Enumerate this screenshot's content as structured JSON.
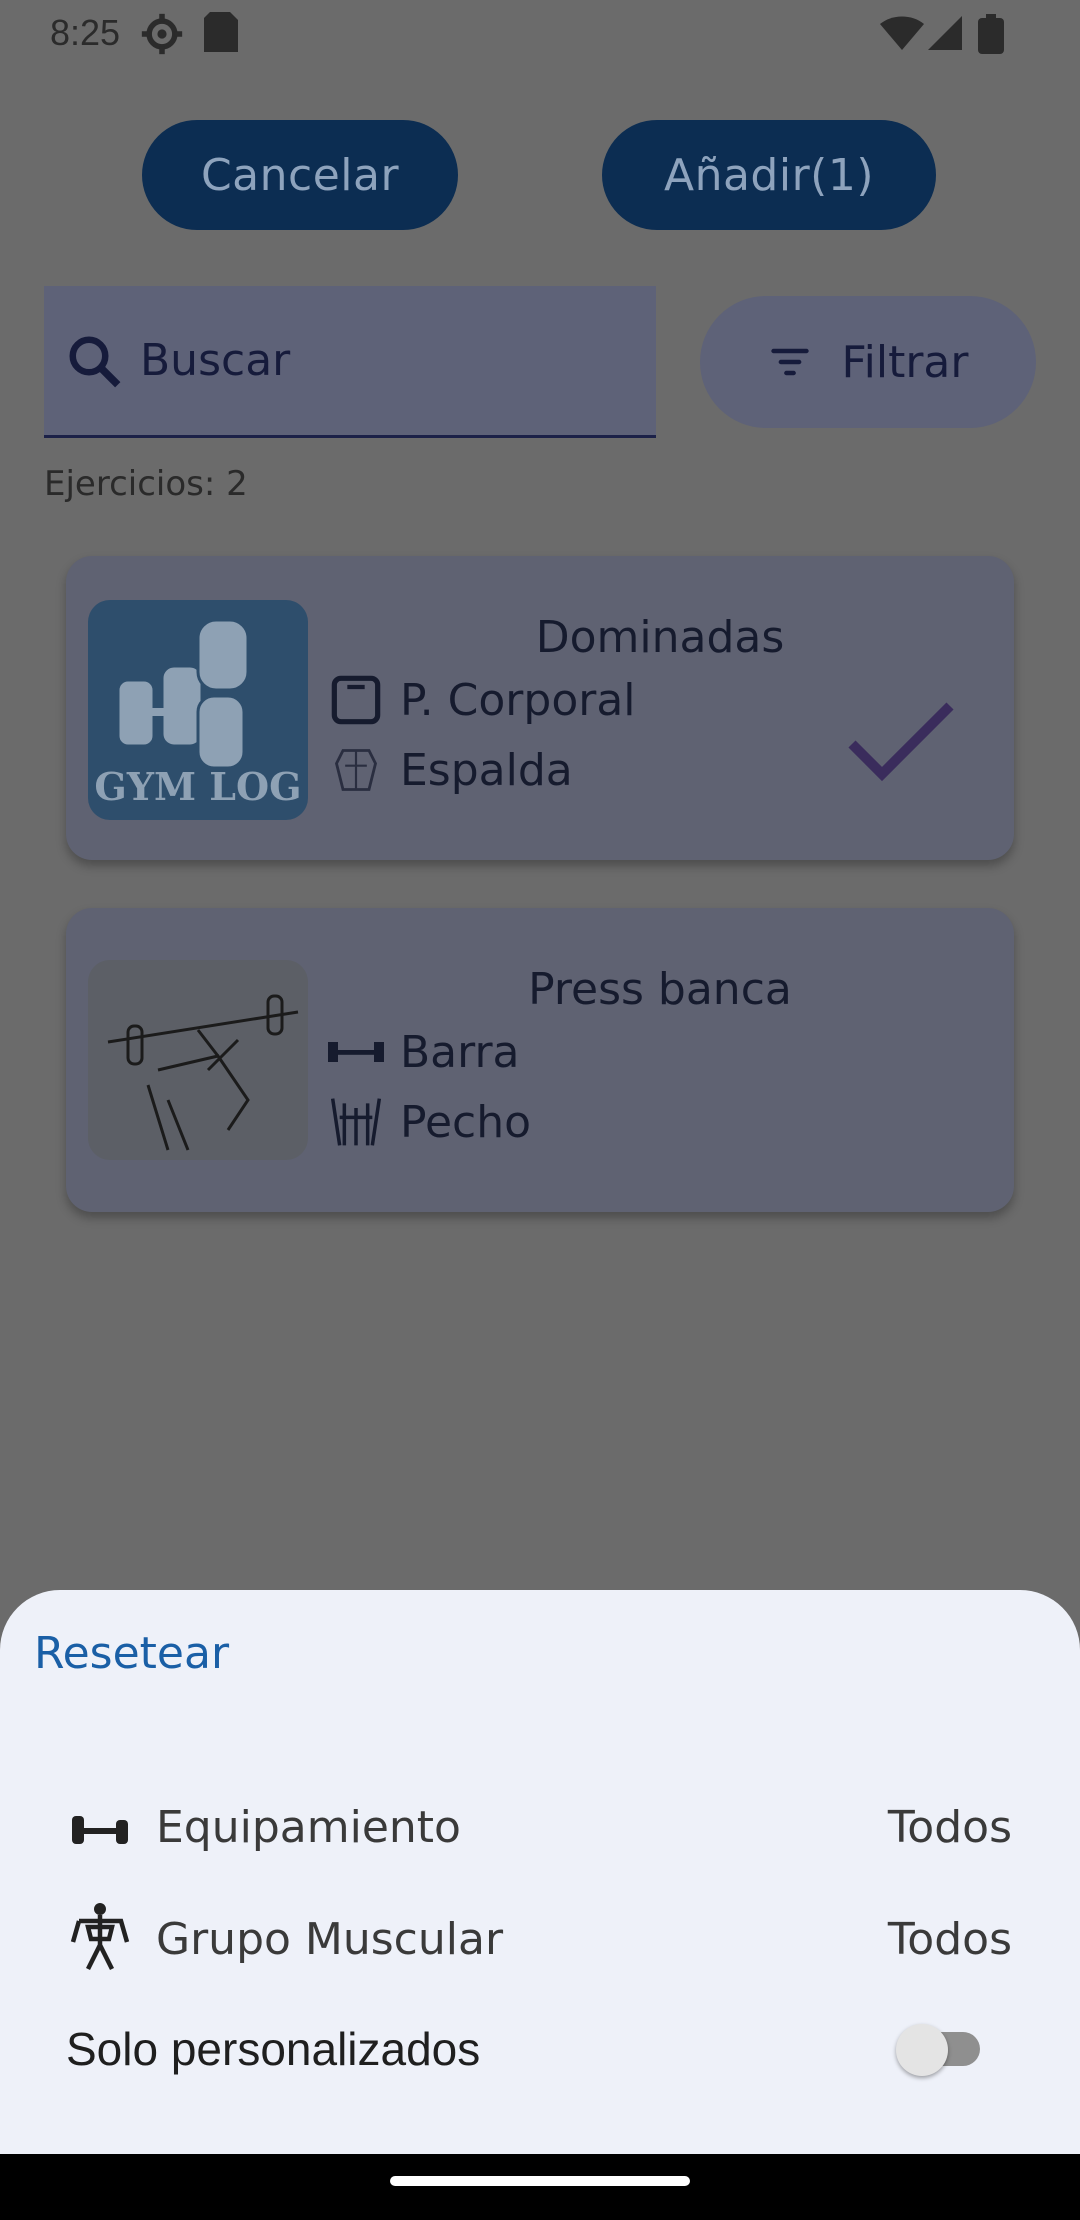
{
  "status_bar": {
    "time": "8:25"
  },
  "header": {
    "cancel_label": "Cancelar",
    "add_label": "Añadir(1)"
  },
  "search": {
    "placeholder": "Buscar"
  },
  "filter": {
    "label": "Filtrar"
  },
  "list": {
    "count_label": "Ejercicios: 2",
    "exercises": [
      {
        "name": "Dominadas",
        "equipment": "P. Corporal",
        "muscle": "Espalda",
        "selected": true,
        "thumb_logo": "GYM LOG"
      },
      {
        "name": "Press banca",
        "equipment": "Barra",
        "muscle": "Pecho",
        "selected": false
      }
    ]
  },
  "sheet": {
    "reset_label": "Resetear",
    "equipment_label": "Equipamiento",
    "equipment_value": "Todos",
    "muscle_label": "Grupo Muscular",
    "muscle_value": "Todos",
    "custom_only_label": "Solo personalizados",
    "custom_only_on": false
  },
  "colors": {
    "accent": "#1a5fa6",
    "button": "#0c2d52",
    "check": "#3a2c5c"
  }
}
